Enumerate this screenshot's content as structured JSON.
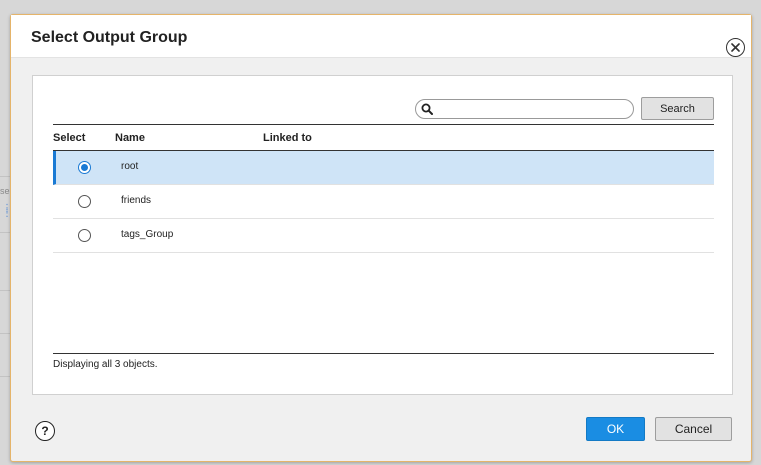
{
  "background": {
    "fragment": "se"
  },
  "dialog": {
    "title": "Select Output Group"
  },
  "search": {
    "placeholder": "",
    "value": "",
    "button_label": "Search"
  },
  "table": {
    "columns": [
      "Select",
      "Name",
      "Linked to"
    ],
    "rows": [
      {
        "name": "root",
        "linked_to": "",
        "selected": true
      },
      {
        "name": "friends",
        "linked_to": "",
        "selected": false
      },
      {
        "name": "tags_Group",
        "linked_to": "",
        "selected": false
      }
    ],
    "footer": "Displaying all 3 objects."
  },
  "footer": {
    "help_label": "?",
    "ok_label": "OK",
    "cancel_label": "Cancel"
  },
  "colors": {
    "accent": "#1a8de3",
    "selected_row": "#cfe4f7",
    "dialog_border": "#e5b46a"
  }
}
